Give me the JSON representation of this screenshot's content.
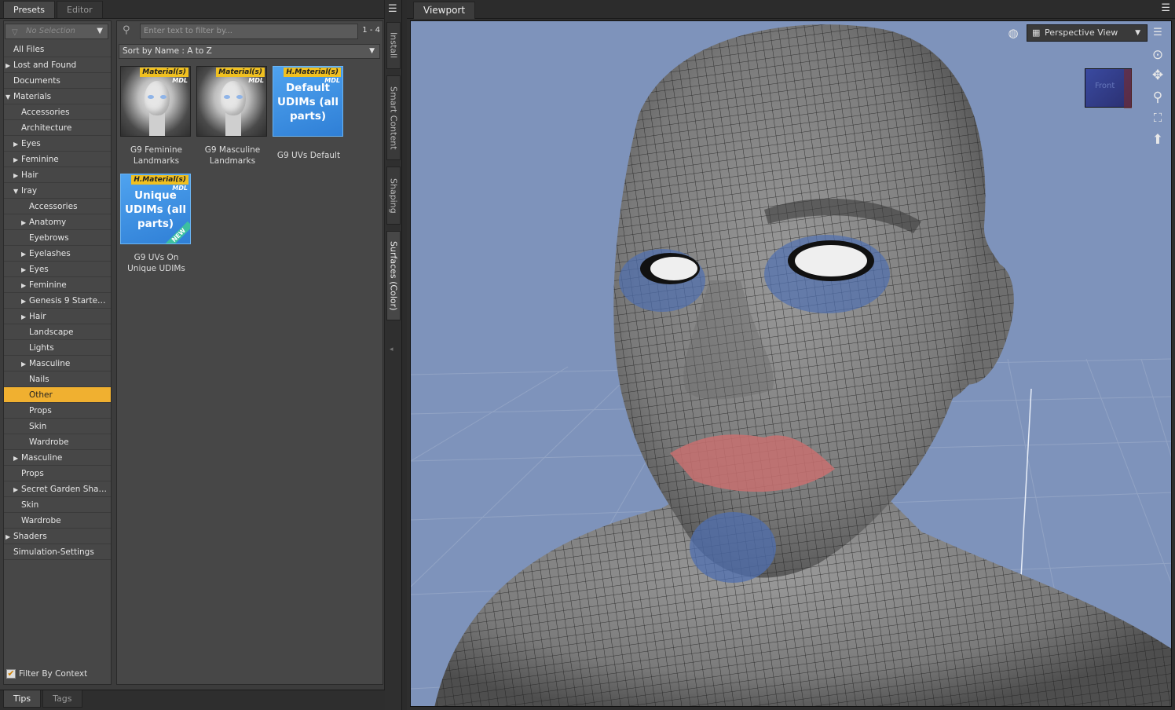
{
  "left_tabs": [
    "Presets",
    "Editor"
  ],
  "selection_dropdown": "No Selection",
  "tree": [
    {
      "label": "All Files",
      "indent": 0,
      "arrow": "",
      "selected": false
    },
    {
      "label": "Lost and Found",
      "indent": 0,
      "arrow": "▶",
      "selected": false
    },
    {
      "label": "Documents",
      "indent": 0,
      "arrow": "",
      "selected": false
    },
    {
      "label": "Materials",
      "indent": 0,
      "arrow": "▼",
      "selected": false
    },
    {
      "label": "Accessories",
      "indent": 1,
      "arrow": "",
      "selected": false
    },
    {
      "label": "Architecture",
      "indent": 1,
      "arrow": "",
      "selected": false
    },
    {
      "label": "Eyes",
      "indent": 1,
      "arrow": "▶",
      "selected": false
    },
    {
      "label": "Feminine",
      "indent": 1,
      "arrow": "▶",
      "selected": false
    },
    {
      "label": "Hair",
      "indent": 1,
      "arrow": "▶",
      "selected": false
    },
    {
      "label": "Iray",
      "indent": 1,
      "arrow": "▼",
      "selected": false
    },
    {
      "label": "Accessories",
      "indent": 2,
      "arrow": "",
      "selected": false
    },
    {
      "label": "Anatomy",
      "indent": 2,
      "arrow": "▶",
      "selected": false
    },
    {
      "label": "Eyebrows",
      "indent": 2,
      "arrow": "",
      "selected": false
    },
    {
      "label": "Eyelashes",
      "indent": 2,
      "arrow": "▶",
      "selected": false
    },
    {
      "label": "Eyes",
      "indent": 2,
      "arrow": "▶",
      "selected": false
    },
    {
      "label": "Feminine",
      "indent": 2,
      "arrow": "▶",
      "selected": false
    },
    {
      "label": "Genesis 9 Starter ...",
      "indent": 2,
      "arrow": "▶",
      "selected": false
    },
    {
      "label": "Hair",
      "indent": 2,
      "arrow": "▶",
      "selected": false
    },
    {
      "label": "Landscape",
      "indent": 2,
      "arrow": "",
      "selected": false
    },
    {
      "label": "Lights",
      "indent": 2,
      "arrow": "",
      "selected": false
    },
    {
      "label": "Masculine",
      "indent": 2,
      "arrow": "▶",
      "selected": false
    },
    {
      "label": "Nails",
      "indent": 2,
      "arrow": "",
      "selected": false
    },
    {
      "label": "Other",
      "indent": 2,
      "arrow": "",
      "selected": true
    },
    {
      "label": "Props",
      "indent": 2,
      "arrow": "",
      "selected": false
    },
    {
      "label": "Skin",
      "indent": 2,
      "arrow": "",
      "selected": false
    },
    {
      "label": "Wardrobe",
      "indent": 2,
      "arrow": "",
      "selected": false
    },
    {
      "label": "Masculine",
      "indent": 1,
      "arrow": "▶",
      "selected": false
    },
    {
      "label": "Props",
      "indent": 1,
      "arrow": "",
      "selected": false
    },
    {
      "label": "Secret Garden Shad...",
      "indent": 1,
      "arrow": "▶",
      "selected": false
    },
    {
      "label": "Skin",
      "indent": 1,
      "arrow": "",
      "selected": false
    },
    {
      "label": "Wardrobe",
      "indent": 1,
      "arrow": "",
      "selected": false
    },
    {
      "label": "Shaders",
      "indent": 0,
      "arrow": "▶",
      "selected": false
    },
    {
      "label": "Simulation-Settings",
      "indent": 0,
      "arrow": "",
      "selected": false
    }
  ],
  "filter_by_context": {
    "label": "Filter By Context",
    "checked": true
  },
  "search": {
    "placeholder": "Enter text to filter by...",
    "count": "1 - 4"
  },
  "sort": {
    "label": "Sort by Name : A to Z"
  },
  "items": [
    {
      "caption": "G9 Feminine Landmarks",
      "kind": "face",
      "tag": "Material(s)",
      "sub": "MDL",
      "text": ""
    },
    {
      "caption": "G9 Masculine Landmarks",
      "kind": "face",
      "tag": "Material(s)",
      "sub": "MDL",
      "text": ""
    },
    {
      "caption": "G9 UVs Default",
      "kind": "blue",
      "tag": "H.Material(s)",
      "sub": "MDL",
      "text": "Default UDIMs (all parts)"
    },
    {
      "caption": "G9 UVs On Unique UDIMs",
      "kind": "blue",
      "tag": "H.Material(s)",
      "sub": "MDL",
      "text": "Unique UDIMs (all parts)",
      "badge": "NEW"
    }
  ],
  "bottom_tabs": [
    "Tips",
    "Tags"
  ],
  "side_tabs": [
    "Install",
    "Smart Content",
    "Shaping",
    "Surfaces (Color)"
  ],
  "viewport": {
    "tab": "Viewport",
    "view_mode": "Perspective View",
    "cube_face": "Front"
  },
  "colors": {
    "accent_selected": "#f0b030",
    "viewport_bg": "#7e93bb",
    "panel_bg": "#474747"
  },
  "icons": {
    "nav": [
      "orbit-icon",
      "pan-icon",
      "zoom-icon",
      "frame-icon",
      "reset-icon"
    ]
  }
}
